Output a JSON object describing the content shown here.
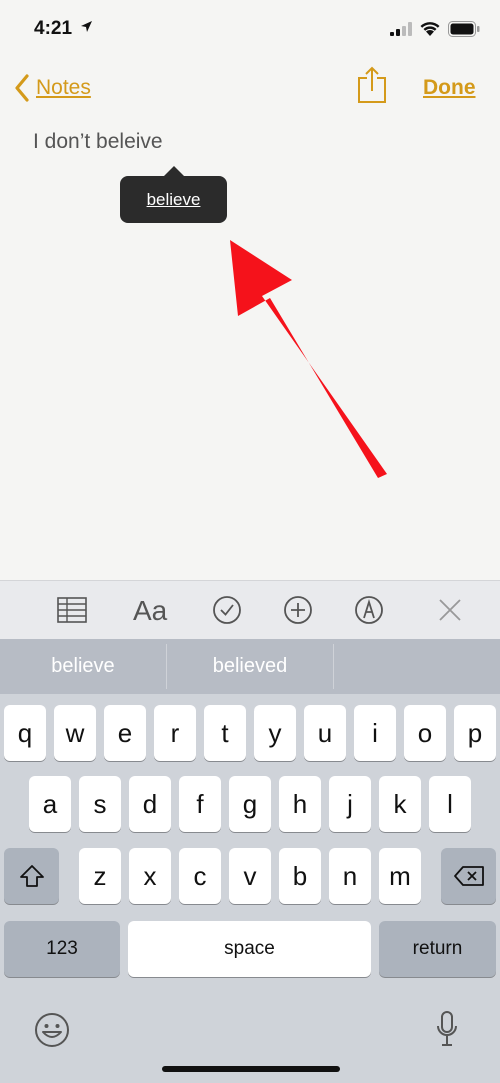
{
  "status": {
    "time": "4:21"
  },
  "nav": {
    "back_label": "Notes",
    "done_label": "Done"
  },
  "note": {
    "text": "I don’t beleive"
  },
  "popup": {
    "suggestion": "believe"
  },
  "predictions": [
    "believe",
    "believed",
    ""
  ],
  "keyboard": {
    "row1": [
      "q",
      "w",
      "e",
      "r",
      "t",
      "y",
      "u",
      "i",
      "o",
      "p"
    ],
    "row2": [
      "a",
      "s",
      "d",
      "f",
      "g",
      "h",
      "j",
      "k",
      "l"
    ],
    "row3": [
      "z",
      "x",
      "c",
      "v",
      "b",
      "n",
      "m"
    ],
    "numbers_label": "123",
    "space_label": "space",
    "return_label": "return"
  },
  "toolbar": {
    "icons": [
      "table-icon",
      "format-icon",
      "checklist-icon",
      "add-icon",
      "markup-icon",
      "close-icon"
    ],
    "format_label": "Aa"
  },
  "colors": {
    "accent": "#d49a1a",
    "arrow": "#f5121b",
    "popup": "#2b2b2b"
  }
}
